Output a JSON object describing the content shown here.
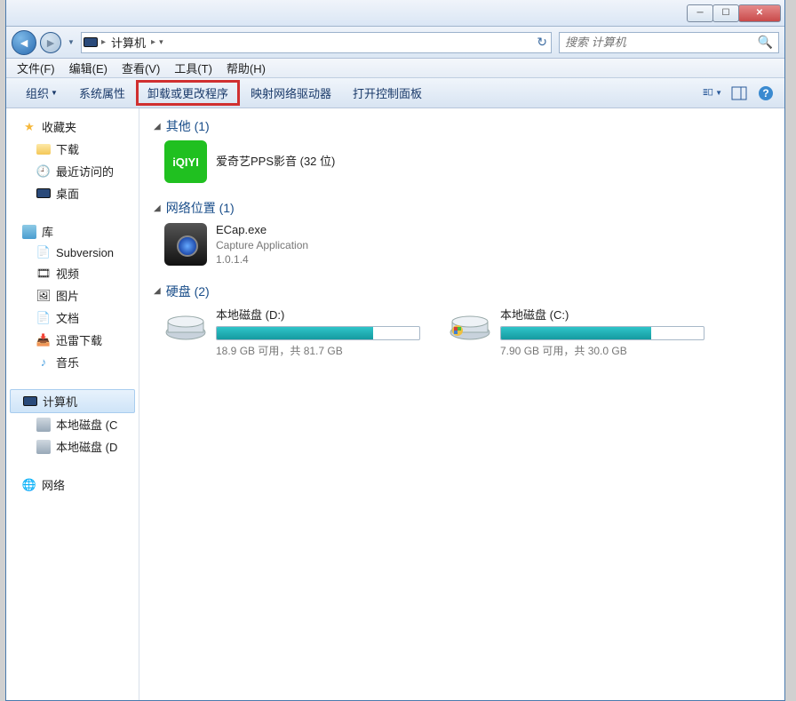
{
  "breadcrumb": {
    "location": "计算机"
  },
  "search": {
    "placeholder": "搜索 计算机"
  },
  "menubar": {
    "file": "文件(F)",
    "edit": "编辑(E)",
    "view": "查看(V)",
    "tools": "工具(T)",
    "help": "帮助(H)"
  },
  "toolbar": {
    "organize": "组织",
    "sys_props": "系统属性",
    "uninstall": "卸载或更改程序",
    "map_drive": "映射网络驱动器",
    "control_panel": "打开控制面板"
  },
  "sidebar": {
    "favorites": "收藏夹",
    "fav_items": {
      "downloads": "下载",
      "recent": "最近访问的",
      "desktop": "桌面"
    },
    "libraries": "库",
    "lib_items": {
      "subversion": "Subversion",
      "video": "视频",
      "pictures": "图片",
      "documents": "文档",
      "xunlei": "迅雷下载",
      "music": "音乐"
    },
    "computer": "计算机",
    "comp_items": {
      "d": "本地磁盘 (C",
      "e": "本地磁盘 (D"
    },
    "network": "网络"
  },
  "content": {
    "other_head": "其他 (1)",
    "other_item": {
      "name": "爱奇艺PPS影音 (32 位)",
      "icon_text": "iQIYI"
    },
    "netloc_head": "网络位置 (1)",
    "netloc_item": {
      "name": "ECap.exe",
      "desc": "Capture Application",
      "ver": "1.0.1.4"
    },
    "drives_head": "硬盘 (2)",
    "drive_d": {
      "label": "本地磁盘 (D:)",
      "stats": "18.9 GB 可用，共 81.7 GB",
      "fill_pct": 77
    },
    "drive_c": {
      "label": "本地磁盘 (C:)",
      "stats": "7.90 GB 可用，共 30.0 GB",
      "fill_pct": 74
    }
  }
}
